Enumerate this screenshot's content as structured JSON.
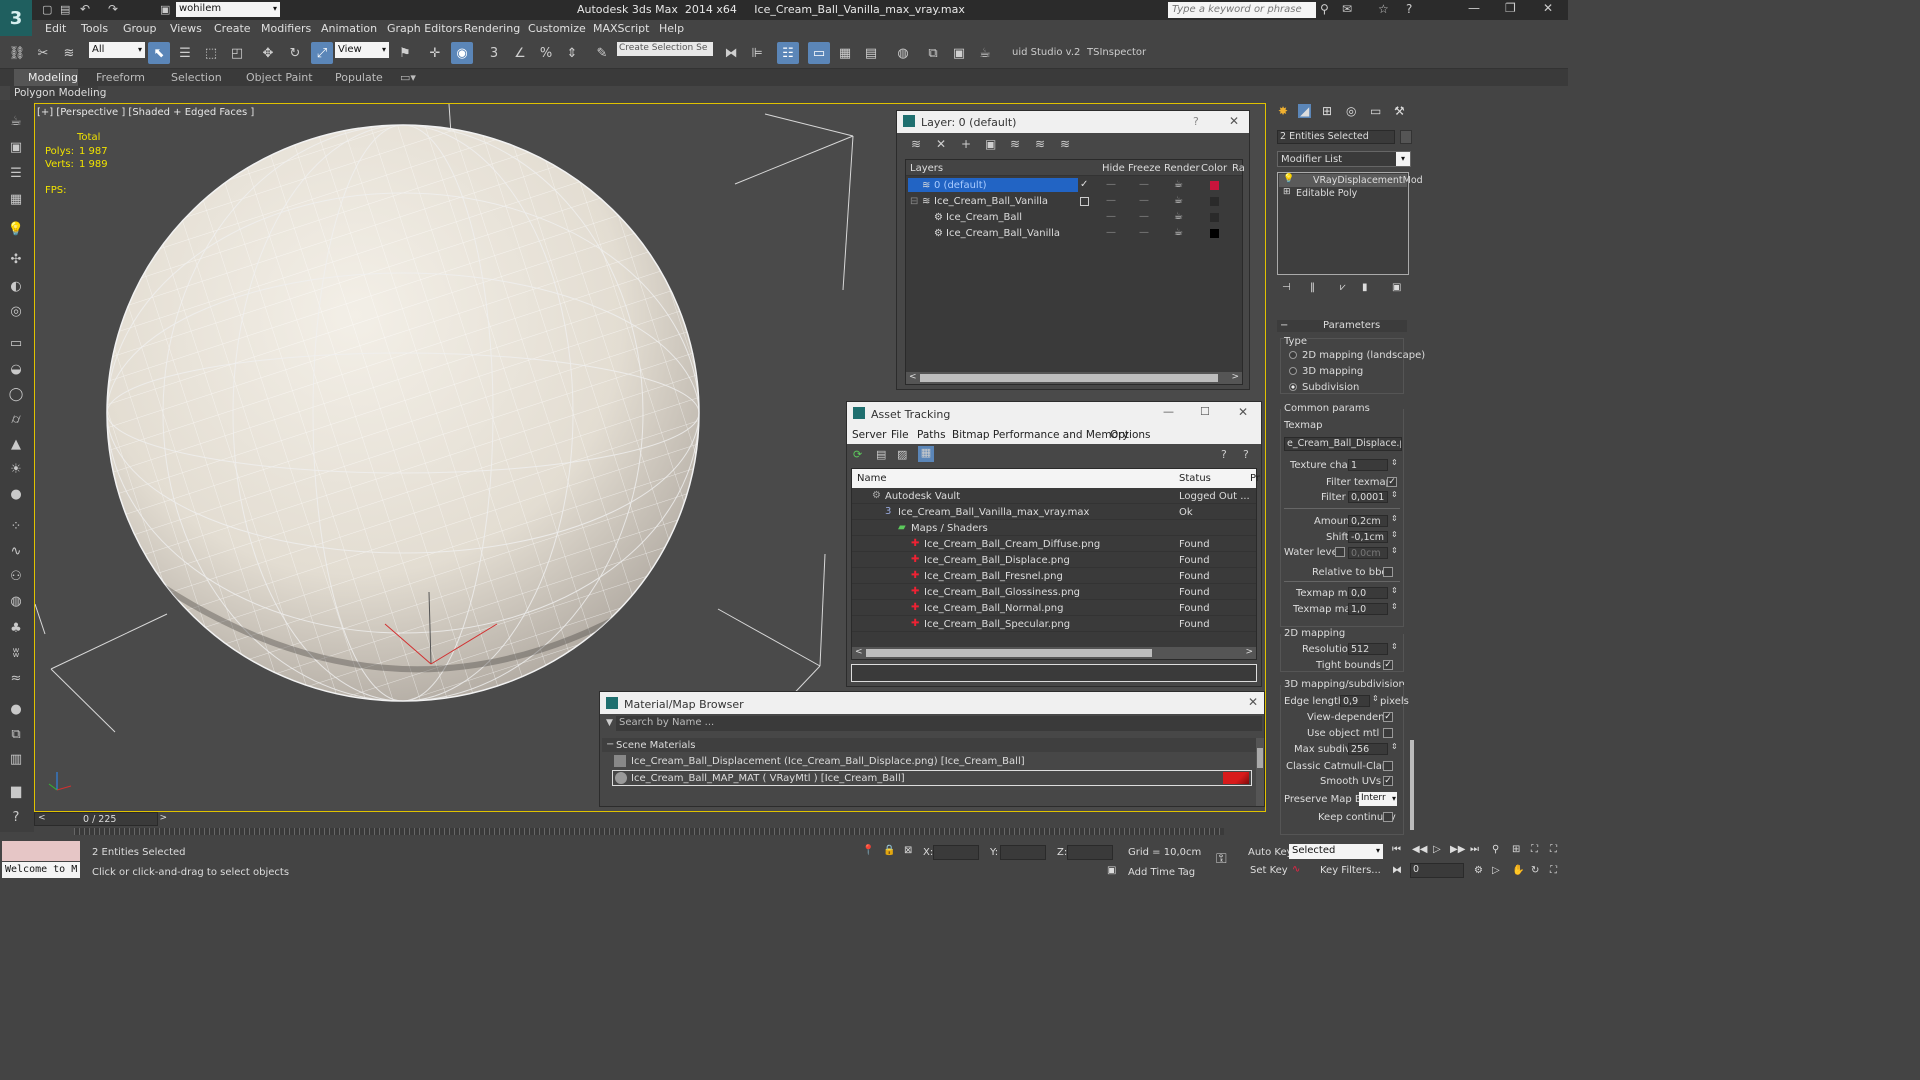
{
  "titlebar": {
    "project": "wohilem",
    "app_title": "Autodesk 3ds Max  2014 x64     Ice_Cream_Ball_Vanilla_max_vray.max",
    "search_placeholder": "Type a keyword or phrase"
  },
  "menu": [
    "Edit",
    "Tools",
    "Group",
    "Views",
    "Create",
    "Modifiers",
    "Animation",
    "Graph Editors",
    "Rendering",
    "Customize",
    "MAXScript",
    "Help"
  ],
  "toolbar": {
    "filter": "All",
    "refcoord": "View",
    "selection_set": "Create Selection Se",
    "studio": "uid Studio v.2",
    "inspector": "TSInspector"
  },
  "ribbon": {
    "tabs": [
      "Modeling",
      "Freeform",
      "Selection",
      "Object Paint",
      "Populate"
    ],
    "sub": "Polygon Modeling"
  },
  "viewport": {
    "label": "[+] [Perspective ] [Shaded + Edged Faces ]",
    "stats_total": "Total",
    "polys_label": "Polys:",
    "polys_value": "1 987",
    "verts_label": "Verts:",
    "verts_value": "1 989",
    "fps_label": "FPS:"
  },
  "layer_dialog": {
    "title": "Layer: 0 (default)",
    "help": "?",
    "columns": [
      "Layers",
      "Hide",
      "Freeze",
      "Render",
      "Color",
      "Ra"
    ],
    "rows": [
      {
        "name": "0 (default)",
        "color": "#c8143c"
      },
      {
        "name": "Ice_Cream_Ball_Vanilla",
        "color": "#2a2a2a"
      },
      {
        "name": "Ice_Cream_Ball",
        "color": "#2a2a2a"
      },
      {
        "name": "Ice_Cream_Ball_Vanilla",
        "color": "#000000"
      }
    ]
  },
  "asset_tracking": {
    "title": "Asset Tracking",
    "menus": [
      "Server",
      "File",
      "Paths",
      "Bitmap Performance and Memory",
      "Options"
    ],
    "columns": [
      "Name",
      "Status",
      "Pr"
    ],
    "rows": [
      {
        "name": "Autodesk Vault",
        "status": "Logged Out ..."
      },
      {
        "name": "Ice_Cream_Ball_Vanilla_max_vray.max",
        "status": "Ok"
      },
      {
        "name": "Maps / Shaders",
        "status": ""
      },
      {
        "name": "Ice_Cream_Ball_Cream_Diffuse.png",
        "status": "Found"
      },
      {
        "name": "Ice_Cream_Ball_Displace.png",
        "status": "Found"
      },
      {
        "name": "Ice_Cream_Ball_Fresnel.png",
        "status": "Found"
      },
      {
        "name": "Ice_Cream_Ball_Glossiness.png",
        "status": "Found"
      },
      {
        "name": "Ice_Cream_Ball_Normal.png",
        "status": "Found"
      },
      {
        "name": "Ice_Cream_Ball_Specular.png",
        "status": "Found"
      }
    ]
  },
  "material_browser": {
    "title": "Material/Map Browser",
    "search_placeholder": "Search by Name ...",
    "group": "Scene Materials",
    "items": [
      "Ice_Cream_Ball_Displacement (Ice_Cream_Ball_Displace.png) [Ice_Cream_Ball]",
      "Ice_Cream_Ball_MAP_MAT ( VRayMtl ) [Ice_Cream_Ball]"
    ]
  },
  "command_panel": {
    "selection": "2 Entities Selected",
    "modifier_list": "Modifier List",
    "stack": [
      "VRayDisplacementMod",
      "Editable Poly"
    ],
    "parameters": "Parameters",
    "type_label": "Type",
    "type_options": [
      "2D mapping (landscape)",
      "3D mapping",
      "Subdivision"
    ],
    "common_params": "Common params",
    "texmap_label": "Texmap",
    "texmap_value": "e_Cream_Ball_Displace.png)",
    "texture_chan_label": "Texture chan",
    "texture_chan_value": "1",
    "filter_texmap_label": "Filter texmap",
    "filter_blur_label": "Filter blur",
    "filter_blur_value": "0,0001",
    "amount_label": "Amount",
    "amount_value": "0,2cm",
    "shift_label": "Shift",
    "shift_value": "-0,1cm",
    "water_level_label": "Water level",
    "water_level_value": "0,0cm",
    "relative_label": "Relative to bbox",
    "texmap_min_label": "Texmap min",
    "texmap_min_value": "0,0",
    "texmap_max_label": "Texmap max",
    "texmap_max_value": "1,0",
    "mapping_2d": "2D mapping",
    "resolution_label": "Resolution",
    "resolution_value": "512",
    "tight_bounds_label": "Tight bounds",
    "mapping_3d": "3D mapping/subdivision",
    "edge_length_label": "Edge length",
    "edge_length_value": "0,9",
    "pixels_label": "pixels",
    "view_dependent_label": "View-dependent",
    "use_object_mtl_label": "Use object mtl",
    "max_subdivs_label": "Max subdivs",
    "max_subdivs_value": "256",
    "catmull_label": "Classic Catmull-Clark",
    "smooth_uvs_label": "Smooth UVs",
    "preserve_label": "Preserve Map Bnd",
    "preserve_value": "Interr",
    "keep_continuity_label": "Keep continuity"
  },
  "status": {
    "timeline": "0 / 225",
    "maxscript": "Welcome to M",
    "selected": "2 Entities Selected",
    "prompt": "Click or click-and-drag to select objects",
    "x_label": "X:",
    "y_label": "Y:",
    "z_label": "Z:",
    "grid": "Grid = 10,0cm",
    "auto_key": "Auto Key",
    "set_key": "Set Key",
    "key_mode": "Selected",
    "key_filters": "Key Filters...",
    "add_time_tag": "Add Time Tag",
    "frame": "0"
  }
}
